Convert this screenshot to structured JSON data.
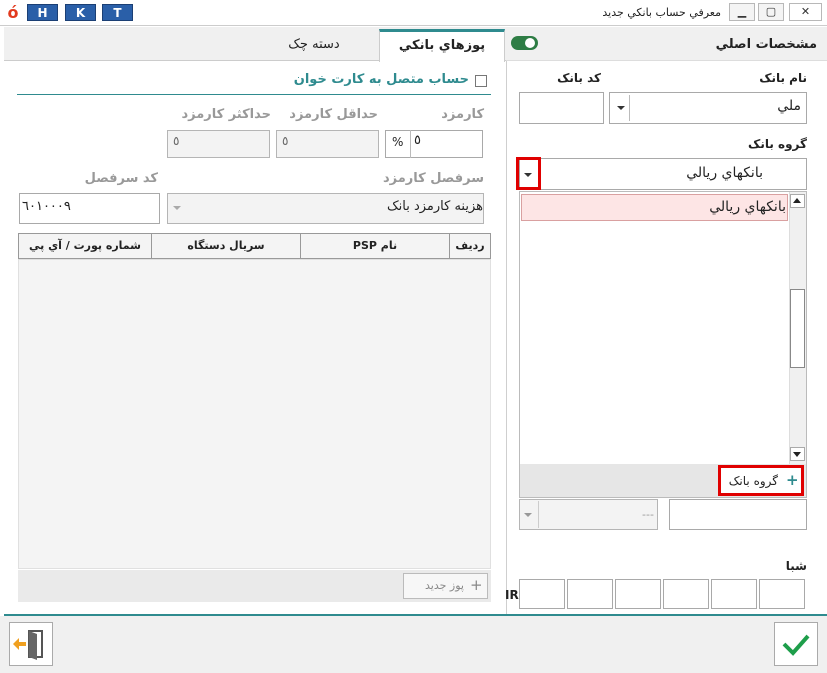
{
  "window": {
    "title": "معرفي حساب بانکي جديد",
    "hkt": [
      "H",
      "K",
      "T"
    ],
    "logo": "ó",
    "minimize_label": "▁",
    "restore_label": "▢",
    "close_label": "✕"
  },
  "tabs": [
    {
      "label": "پوزهاي بانکي",
      "active": true
    },
    {
      "label": "دسته چک",
      "active": false
    }
  ],
  "right_panel": {
    "header_label": "مشخصات اصلي",
    "toggle_on": true,
    "bank_name_label": "نام بانک",
    "bank_name_value": "ملي",
    "bank_code_label": "کد بانک",
    "bank_code_value": "",
    "bank_group_label": "گروه بانک",
    "bank_group_value": "بانکهاي ريالي",
    "dropdown_items": [
      "بانکهاي ريالي"
    ],
    "add_group_label": "گروه بانک",
    "lower_select_value": "---",
    "sheba_label": "شبا",
    "sheba_prefix": "IR"
  },
  "pos_tab": {
    "card_reader_label": "حساب متصل به کارت خوان",
    "card_reader_checked": false,
    "fee_label": "کارمزد",
    "fee_value": "٥",
    "fee_unit": "%",
    "min_fee_label": "حداقل کارمزد",
    "min_fee_value": "٥",
    "max_fee_label": "حداکثر کارمزد",
    "max_fee_value": "٥",
    "fee_header_label": "سرفصل کارمزد",
    "fee_header_value": "هزينه کارمزد بانک",
    "header_code_label": "کد سرفصل",
    "header_code_value": "٦٠١٠٠٠٩",
    "grid_columns": [
      "رديف",
      "نام PSP",
      "سريال دستگاه",
      "شماره پورت / آي پي"
    ],
    "new_pos_label": "پوز جديد"
  },
  "colors": {
    "accent": "#2f8b8f",
    "hkt_blue": "#2a5fa8",
    "highlight_red": "#e00000",
    "toggle_green": "#2e7d45",
    "selected_item_bg": "#fde5e5",
    "ok_green": "#1e9e4a",
    "exit_orange": "#f0a020"
  },
  "icons": {
    "toggle": "toggle-switch-icon",
    "add": "plus-icon",
    "ok": "checkmark-icon",
    "exit": "exit-door-icon"
  }
}
